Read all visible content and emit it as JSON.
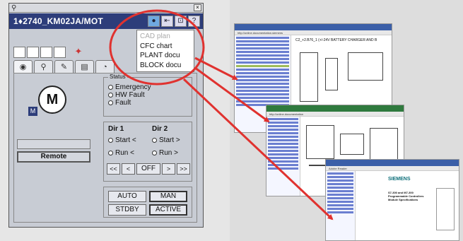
{
  "window": {
    "tag": "1♦2740_KM02JA/MOT",
    "close_label": "×",
    "header_buttons": [
      {
        "icon": "globe-icon",
        "glyph": "●"
      },
      {
        "icon": "pin-icon",
        "glyph": "⇤"
      },
      {
        "icon": "zoom-icon",
        "glyph": "⊡"
      },
      {
        "icon": "help-icon",
        "glyph": "?"
      }
    ]
  },
  "dropdown": {
    "items": [
      "CAD plan",
      "CFC chart",
      "PLANT docu",
      "BLOCK docu"
    ]
  },
  "tabs": [
    {
      "icon": "eye-icon",
      "glyph": "◉"
    },
    {
      "icon": "search-icon",
      "glyph": "⚲"
    },
    {
      "icon": "wrench-icon",
      "glyph": "✎"
    },
    {
      "icon": "chart-icon",
      "glyph": "▤"
    },
    {
      "icon": "trend-icon",
      "glyph": "◔"
    }
  ],
  "motor": {
    "symbol": "M",
    "badge": "M",
    "mode_text": "Remote"
  },
  "status": {
    "legend": "Status",
    "items": [
      "Emergency",
      "HW Fault",
      "Fault"
    ]
  },
  "direction": {
    "dir1_label": "Dir 1",
    "dir2_label": "Dir 2",
    "dir1": [
      "Start <",
      "Run <"
    ],
    "dir2": [
      "Start >",
      "Run >"
    ],
    "step_buttons": [
      "<<",
      "<",
      "OFF",
      ">",
      ">>"
    ]
  },
  "mode_buttons": {
    "auto": "AUTO",
    "man": "MAN",
    "stdby": "STDBY",
    "active": "ACTIVE"
  },
  "documents": {
    "doc1_title": "C2_+2.B76_1 (+/-24V BATTERY CHARGER AND B",
    "doc3_brand": "SIEMENS",
    "doc3_product": "S7-300 and M7-300 Programmable Controllers Module Specifications"
  },
  "colors": {
    "header_blue": "#2d3d7a",
    "highlight_red": "#e0322f"
  }
}
